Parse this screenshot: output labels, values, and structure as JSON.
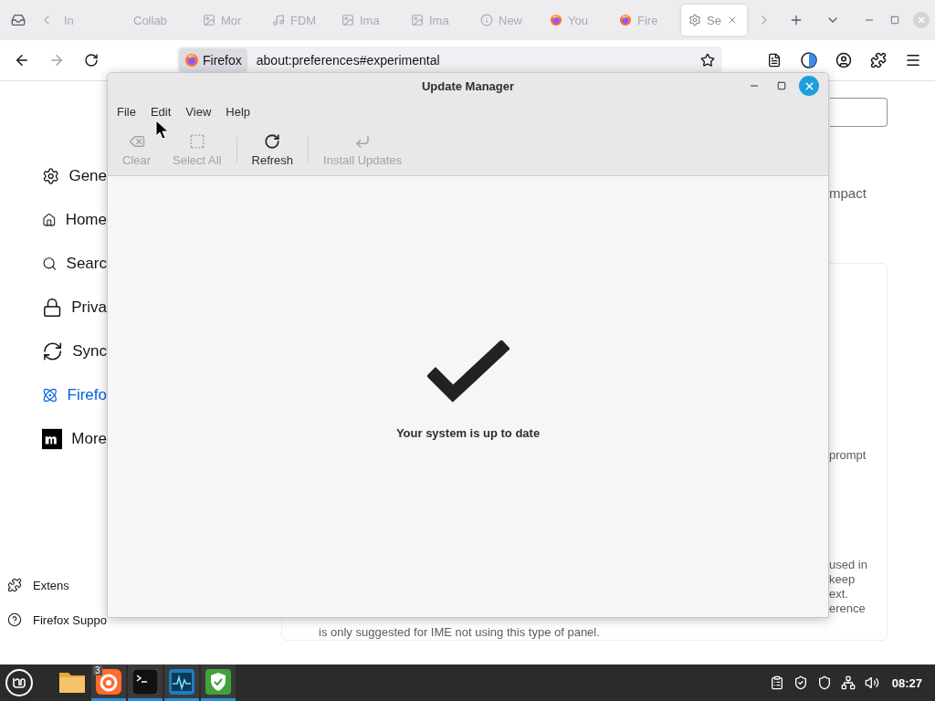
{
  "browser": {
    "tabs": [
      {
        "label": "In",
        "kind": "none",
        "selected": false
      },
      {
        "label": "Collab",
        "kind": "none",
        "selected": false
      },
      {
        "label": "Mor",
        "kind": "image",
        "selected": false
      },
      {
        "label": "FDM",
        "kind": "note",
        "selected": false
      },
      {
        "label": "Ima",
        "kind": "image",
        "selected": false
      },
      {
        "label": "Ima",
        "kind": "image",
        "selected": false
      },
      {
        "label": "New",
        "kind": "info",
        "selected": false
      },
      {
        "label": "You",
        "kind": "firefox",
        "selected": false
      },
      {
        "label": "Fire",
        "kind": "firefox",
        "selected": false
      },
      {
        "label": "Se",
        "kind": "gear",
        "selected": true
      }
    ],
    "identity": "Firefox",
    "url": "about:preferences#experimental",
    "sidebar": {
      "items": [
        {
          "label": "Gene",
          "kind": "gear",
          "selected": false
        },
        {
          "label": "Home",
          "kind": "home",
          "selected": false
        },
        {
          "label": "Searc",
          "kind": "search",
          "selected": false
        },
        {
          "label": "Priva",
          "kind": "lock",
          "selected": false
        },
        {
          "label": "Sync",
          "kind": "sync",
          "selected": false
        },
        {
          "label": "Firefo",
          "kind": "atom",
          "selected": true
        },
        {
          "label": "More",
          "kind": "mozilla",
          "selected": false
        }
      ],
      "footer": [
        {
          "label": "Extens",
          "kind": "puzzle"
        },
        {
          "label": "Firefox Suppo",
          "kind": "help"
        }
      ]
    },
    "content": {
      "heading_fragment": "mpact",
      "card": {
        "fragments": [
          "prompt"
        ],
        "paragraph_fragments": [
          "used in",
          "keep",
          "ext.",
          "erence"
        ],
        "last_line": "is only suggested for IME not using this type of panel."
      }
    }
  },
  "update_manager": {
    "title": "Update Manager",
    "menu": [
      "File",
      "Edit",
      "View",
      "Help"
    ],
    "toolbar": [
      {
        "label": "Clear",
        "kind": "clear",
        "disabled": true
      },
      {
        "label": "Select All",
        "kind": "select",
        "disabled": true
      },
      {
        "label": "Refresh",
        "kind": "refresh",
        "disabled": false
      },
      {
        "label": "Install Updates",
        "kind": "install",
        "disabled": true
      }
    ],
    "status": "Your system is up to date"
  },
  "taskbar": {
    "apps": [
      {
        "kind": "files",
        "running": false
      },
      {
        "kind": "firefox",
        "running": true,
        "badge": "3"
      },
      {
        "kind": "terminal",
        "running": true
      },
      {
        "kind": "monitor",
        "running": true
      },
      {
        "kind": "shield",
        "running": true
      }
    ],
    "clock": "08:27"
  }
}
